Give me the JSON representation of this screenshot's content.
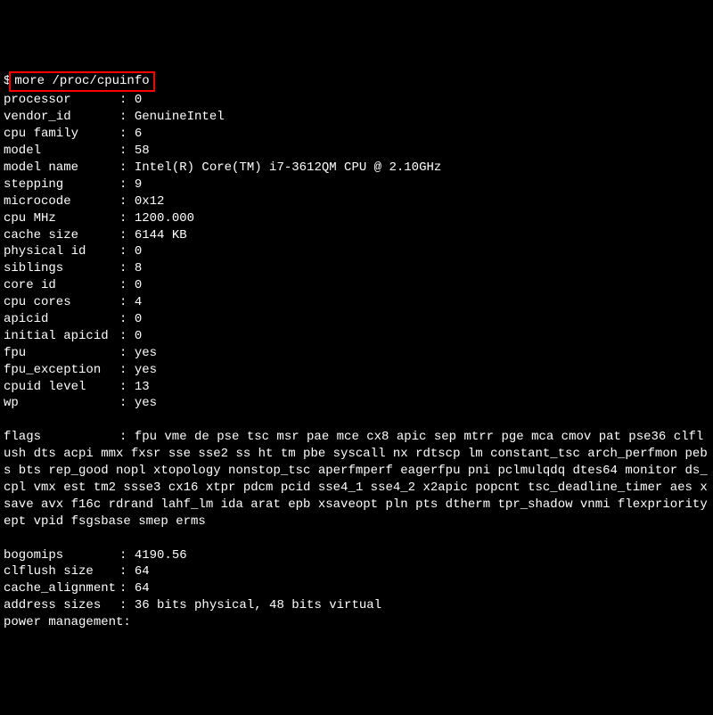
{
  "prompt": "$",
  "command": "more /proc/cpuinfo",
  "rows": [
    {
      "key": "processor",
      "value": "0"
    },
    {
      "key": "vendor_id",
      "value": "GenuineIntel"
    },
    {
      "key": "cpu family",
      "value": "6"
    },
    {
      "key": "model",
      "value": "58"
    },
    {
      "key": "model name",
      "value": "Intel(R) Core(TM) i7-3612QM CPU @ 2.10GHz"
    },
    {
      "key": "stepping",
      "value": "9"
    },
    {
      "key": "microcode",
      "value": "0x12"
    },
    {
      "key": "cpu MHz",
      "value": "1200.000"
    },
    {
      "key": "cache size",
      "value": "6144 KB"
    },
    {
      "key": "physical id",
      "value": "0"
    },
    {
      "key": "siblings",
      "value": "8"
    },
    {
      "key": "core id",
      "value": "0"
    },
    {
      "key": "cpu cores",
      "value": "4"
    },
    {
      "key": "apicid",
      "value": "0"
    },
    {
      "key": "initial apicid",
      "value": "0"
    },
    {
      "key": "fpu",
      "value": "yes"
    },
    {
      "key": "fpu_exception",
      "value": "yes"
    },
    {
      "key": "cpuid level",
      "value": "13"
    },
    {
      "key": "wp",
      "value": "yes"
    }
  ],
  "flags_key": "flags",
  "flags_line": ": fpu vme de pse tsc msr pae mce cx8 apic sep mtrr pge mca cmov pat pse36 clflush dts acpi mmx fxsr sse sse2 ss ht tm pbe syscall nx rdtscp lm constant_tsc arch_perfmon pebs bts rep_good nopl xtopology nonstop_tsc aperfmperf eagerfpu pni pclmulqdq dtes64 monitor ds_cpl vmx est tm2 ssse3 cx16 xtpr pdcm pcid sse4_1 sse4_2 x2apic popcnt tsc_deadline_timer aes xsave avx f16c rdrand lahf_lm ida arat epb xsaveopt pln pts dtherm tpr_shadow vnmi flexpriority ept vpid fsgsbase smep erms",
  "tail_rows": [
    {
      "key": "bogomips",
      "value": "4190.56"
    },
    {
      "key": "clflush size",
      "value": "64"
    },
    {
      "key": "cache_alignment",
      "value": "64"
    },
    {
      "key": "address sizes",
      "value": "36 bits physical, 48 bits virtual"
    },
    {
      "key": "power management",
      "value": "",
      "nosep": true
    }
  ]
}
